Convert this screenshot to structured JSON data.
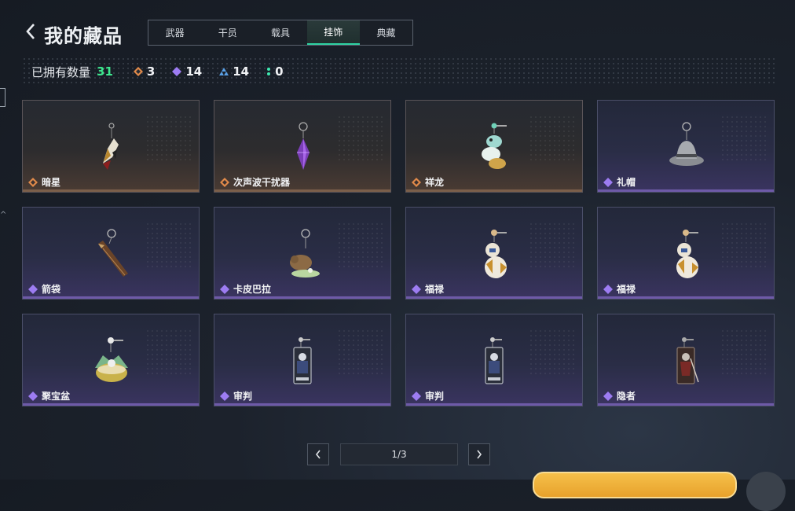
{
  "header": {
    "title": "我的藏品",
    "tabs": [
      {
        "label": "武器",
        "active": false
      },
      {
        "label": "干员",
        "active": false
      },
      {
        "label": "载具",
        "active": false
      },
      {
        "label": "挂饰",
        "active": true
      },
      {
        "label": "典藏",
        "active": false
      }
    ]
  },
  "stats": {
    "owned_label": "已拥有数量",
    "owned_count": "31",
    "rarities": [
      {
        "icon": "orange-diamond-icon",
        "color": "#e08a4a",
        "value": "3"
      },
      {
        "icon": "purple-diamond-icon",
        "color": "#9d7cf2",
        "value": "14"
      },
      {
        "icon": "blue-triangle-icon",
        "color": "#5aa0e6",
        "value": "14"
      },
      {
        "icon": "green-dots-icon",
        "color": "#3ee8b0",
        "value": "0"
      }
    ]
  },
  "items": [
    {
      "name": "暗星",
      "rarity": "orange"
    },
    {
      "name": "次声波干扰器",
      "rarity": "orange"
    },
    {
      "name": "祥龙",
      "rarity": "orange"
    },
    {
      "name": "礼帽",
      "rarity": "purple"
    },
    {
      "name": "箭袋",
      "rarity": "purple"
    },
    {
      "name": "卡皮巴拉",
      "rarity": "purple"
    },
    {
      "name": "福禄",
      "rarity": "purple"
    },
    {
      "name": "福禄",
      "rarity": "purple"
    },
    {
      "name": "聚宝盆",
      "rarity": "purple"
    },
    {
      "name": "审判",
      "rarity": "purple"
    },
    {
      "name": "审判",
      "rarity": "purple"
    },
    {
      "name": "隐者",
      "rarity": "purple"
    }
  ],
  "pager": {
    "text": "1/3"
  },
  "colors": {
    "accent": "#2fd3a4",
    "owned_count": "#3ee88f"
  }
}
